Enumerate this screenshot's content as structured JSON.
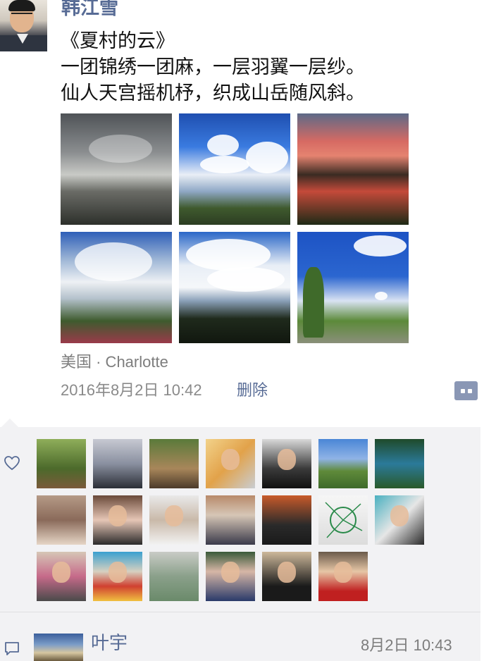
{
  "post": {
    "author": "韩江雪",
    "text_lines": [
      "《夏村的云》",
      "一团锦绣一团麻，一层羽翼一层纱。",
      "仙人天宫摇机杼，织成山岳随风斜。"
    ],
    "photos": [
      "sunset-cloudy-flag",
      "blue-sky-clouds-park",
      "red-sunset-pond-reflection",
      "clouds-over-garden",
      "clouds-over-trees",
      "blue-sky-tree-field"
    ],
    "location": "美国 · Charlotte",
    "timestamp": "2016年8月2日 10:42",
    "delete_label": "删除"
  },
  "icons": {
    "comment_button": "comment-dots-icon",
    "like": "heart-outline-icon",
    "comment": "speech-bubble-icon"
  },
  "likes": {
    "count": 20,
    "avatars": [
      "forest-path",
      "lake-silhouette",
      "bridge-walker",
      "golden-hour-portrait",
      "headphones-selfie",
      "green-hills",
      "waterfall",
      "rock-beach",
      "couple-selfie",
      "young-man-portrait",
      "city-square",
      "museum-photo",
      "green-line-sketch",
      "street-mural-couple",
      "baby-stroller",
      "monkey-toy",
      "stone-gate",
      "couple-smiling",
      "woman-portrait",
      "older-woman"
    ]
  },
  "comments": [
    {
      "author": "叶宇",
      "time": "8月2日 10:43"
    }
  ],
  "colors": {
    "link": "#576b95",
    "panel": "#f2f2f4",
    "muted": "#8a8a8a"
  }
}
